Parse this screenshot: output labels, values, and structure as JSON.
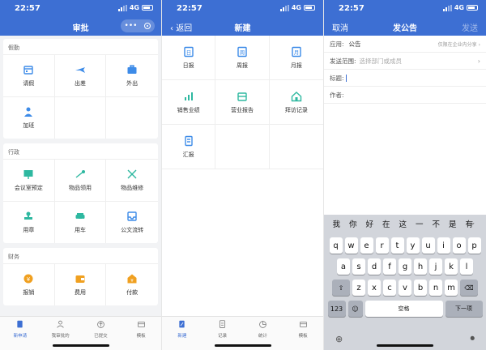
{
  "status": {
    "time": "22:57",
    "network": "4G"
  },
  "screen1": {
    "title": "审批",
    "capsule_dots": "•••",
    "sections": [
      {
        "title": "假勤",
        "items": [
          {
            "label": "请假",
            "icon": "calendar-icon",
            "color": "#3d8be8"
          },
          {
            "label": "出差",
            "icon": "airplane-icon",
            "color": "#3d8be8"
          },
          {
            "label": "外出",
            "icon": "briefcase-icon",
            "color": "#3d8be8"
          },
          {
            "label": "加班",
            "icon": "person-clock-icon",
            "color": "#3d8be8"
          }
        ]
      },
      {
        "title": "行政",
        "items": [
          {
            "label": "会议室预定",
            "icon": "meeting-room-icon",
            "color": "#2eb8a0"
          },
          {
            "label": "物品领用",
            "icon": "hand-item-icon",
            "color": "#2eb8a0"
          },
          {
            "label": "物品维修",
            "icon": "tools-icon",
            "color": "#2eb8a0"
          },
          {
            "label": "用章",
            "icon": "stamp-icon",
            "color": "#2eb8a0"
          },
          {
            "label": "用车",
            "icon": "car-icon",
            "color": "#2eb8a0"
          },
          {
            "label": "公文流转",
            "icon": "inbox-icon",
            "color": "#3d8be8"
          }
        ]
      },
      {
        "title": "财务",
        "items": [
          {
            "label": "报销",
            "icon": "coin-icon",
            "color": "#f0a020"
          },
          {
            "label": "费用",
            "icon": "wallet-icon",
            "color": "#f0a020"
          },
          {
            "label": "付款",
            "icon": "payment-house-icon",
            "color": "#f0a020"
          }
        ]
      }
    ],
    "tabs": [
      {
        "label": "新申请",
        "active": true
      },
      {
        "label": "我审批的",
        "active": false
      },
      {
        "label": "已提交",
        "active": false
      },
      {
        "label": "模板",
        "active": false
      }
    ]
  },
  "screen2": {
    "back": "返回",
    "title": "新建",
    "items": [
      {
        "label": "日报",
        "icon": "daily-report-icon",
        "color": "#3d8be8",
        "glyph": "日"
      },
      {
        "label": "周报",
        "icon": "weekly-report-icon",
        "color": "#3d8be8",
        "glyph": "周"
      },
      {
        "label": "月报",
        "icon": "monthly-report-icon",
        "color": "#3d8be8",
        "glyph": "月"
      },
      {
        "label": "销售业绩",
        "icon": "bar-chart-icon",
        "color": "#2eb8a0",
        "glyph": ""
      },
      {
        "label": "营业报告",
        "icon": "store-icon",
        "color": "#2eb8a0",
        "glyph": ""
      },
      {
        "label": "拜访记录",
        "icon": "house-visit-icon",
        "color": "#2eb8a0",
        "glyph": ""
      },
      {
        "label": "汇报",
        "icon": "document-icon",
        "color": "#3d8be8",
        "glyph": ""
      }
    ],
    "tabs": [
      {
        "label": "新建",
        "active": true
      },
      {
        "label": "记录",
        "active": false
      },
      {
        "label": "统计",
        "active": false
      },
      {
        "label": "模板",
        "active": false
      }
    ]
  },
  "screen3": {
    "cancel": "取消",
    "title": "发公告",
    "send": "发送",
    "app_label": "应用:",
    "app_value": "公告",
    "app_hint": "仅限在企业内分享",
    "scope_label": "发送范围:",
    "scope_placeholder": "选择部门或成员",
    "subject_label": "标题:",
    "author_label": "作者:",
    "candidates": [
      "我",
      "你",
      "好",
      "在",
      "这",
      "一",
      "不",
      "是",
      "有"
    ],
    "row1": [
      "q",
      "w",
      "e",
      "r",
      "t",
      "y",
      "u",
      "i",
      "o",
      "p"
    ],
    "row2": [
      "a",
      "s",
      "d",
      "f",
      "g",
      "h",
      "j",
      "k",
      "l"
    ],
    "row3": [
      "z",
      "x",
      "c",
      "v",
      "b",
      "n",
      "m"
    ],
    "num_key": "123",
    "space_key": "空格",
    "next_key": "下一项"
  }
}
